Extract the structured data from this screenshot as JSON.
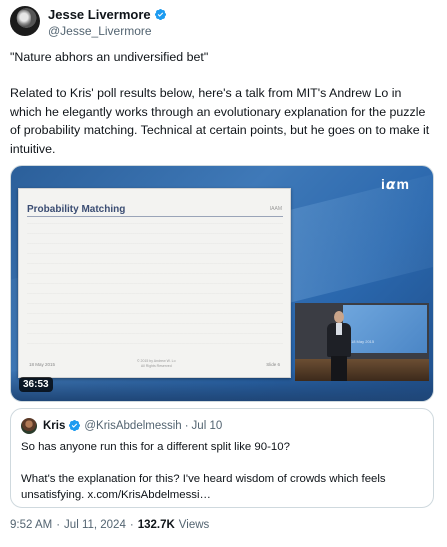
{
  "author": {
    "display_name": "Jesse Livermore",
    "handle": "@Jesse_Livermore",
    "verified": true
  },
  "tweet": {
    "line1": "\"Nature abhors an undiversified bet\"",
    "paragraph2": "Related to Kris' poll results below, here's a talk from MIT's Andrew Lo in which he elegantly works through an evolutionary explanation for the puzzle of probability matching. Technical at certain points, but he goes on to make it intuitive."
  },
  "video": {
    "duration": "36:53",
    "brand_logo": "i𝞪m",
    "slide_title": "Probability Matching",
    "slide_brand": "IAAM",
    "slide_date": "18 May 2015",
    "slide_number": "Slide 6",
    "slide_copyright": "© 2015 by Andrew W. Lo\nAll Rights Reserved",
    "inset_screen_text": "18 May 2015"
  },
  "quote": {
    "display_name": "Kris",
    "handle": "@KrisAbdelmessih",
    "separator": "·",
    "date": "Jul 10",
    "line1": "So has anyone run this for a different split like 90-10?",
    "line2": "What's the explanation for this? I've heard wisdom of crowds which feels unsatisfying. x.com/KrisAbdelmessi…"
  },
  "meta": {
    "time": "9:52 AM",
    "separator": "·",
    "date": "Jul 11, 2024",
    "separator2": "·",
    "views_count": "132.7K",
    "views_label": "Views"
  },
  "colors": {
    "verified_blue": "#1d9bf0",
    "secondary_text": "#536471"
  }
}
